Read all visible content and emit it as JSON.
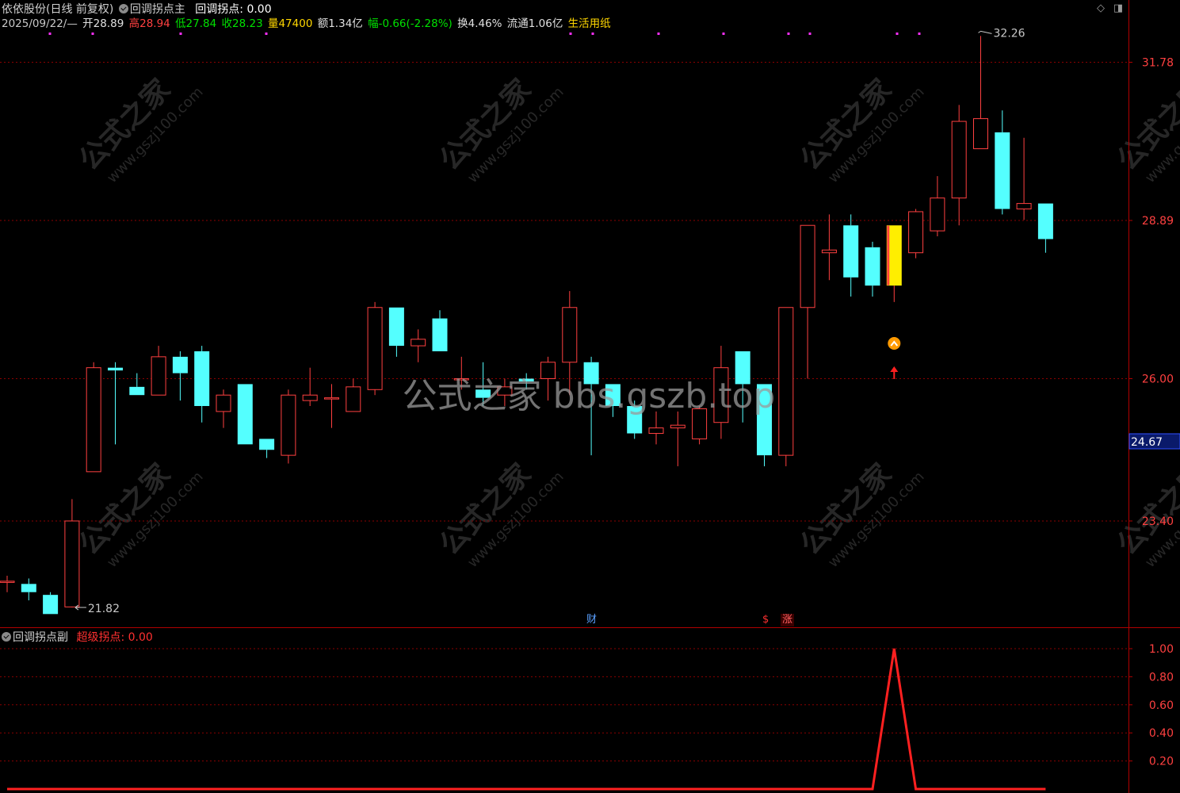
{
  "main_header": {
    "stock_name": "依依股份(日线 前复权)",
    "formula_name": "回调拐点主",
    "indicator": "回调拐点: 0.00"
  },
  "info_bar": {
    "date": "2025/09/22/—",
    "open": "开28.89",
    "high": "高28.94",
    "low": "低27.84",
    "close": "收28.23",
    "volume": "量47400",
    "amount": "额1.34亿",
    "change": "幅-0.66(-2.28%)",
    "turnover": "换4.46%",
    "float": "流通1.06亿",
    "sector": "生活用纸"
  },
  "price_axis": {
    "ticks": [
      "31.78",
      "28.89",
      "26.00",
      "23.40"
    ],
    "current_price": "24.67"
  },
  "annotations": {
    "max_label": "32.26",
    "min_label": "21.82"
  },
  "event_markers": [
    {
      "label": "财",
      "color": "#5aa0ff"
    },
    {
      "label": "$",
      "color": "#ff3030"
    },
    {
      "label": "涨",
      "color": "#ff6060"
    }
  ],
  "sub_header": {
    "formula_name": "回调拐点副",
    "indicator": "超级拐点: 0.00"
  },
  "sub_axis": {
    "ticks": [
      "1.00",
      "0.80",
      "0.60",
      "0.40",
      "0.20"
    ]
  },
  "watermarks": {
    "center": "公式之家 bbs.gszb.top",
    "tile_cn": "公式之家",
    "tile_url": "www.gszj100.com"
  },
  "colors": {
    "up": "#ff4040",
    "down": "#54ffff",
    "signal": "#ffee00",
    "grid": "#8b0000",
    "axis": "#b00000",
    "date": "#c8c8c8",
    "high": "#ff4040",
    "low": "#00e000",
    "close": "#00e000",
    "volume": "#ffd700",
    "change": "#00e000",
    "sector": "#ffd700"
  },
  "chart_data": {
    "type": "candlestick",
    "price_range": [
      21.1,
      33.0
    ],
    "signal_candle_index": 41,
    "candles": [
      {
        "o": 22.3,
        "h": 22.4,
        "l": 22.1,
        "c": 22.3
      },
      {
        "o": 22.25,
        "h": 22.35,
        "l": 21.95,
        "c": 22.1
      },
      {
        "o": 22.05,
        "h": 22.1,
        "l": 21.7,
        "c": 21.7
      },
      {
        "o": 21.83,
        "h": 23.8,
        "l": 21.82,
        "c": 23.4
      },
      {
        "o": 24.3,
        "h": 26.3,
        "l": 24.3,
        "c": 26.2
      },
      {
        "o": 26.2,
        "h": 26.3,
        "l": 24.8,
        "c": 26.15
      },
      {
        "o": 25.85,
        "h": 26.1,
        "l": 25.7,
        "c": 25.7
      },
      {
        "o": 25.7,
        "h": 26.6,
        "l": 25.7,
        "c": 26.4
      },
      {
        "o": 26.4,
        "h": 26.5,
        "l": 25.6,
        "c": 26.1
      },
      {
        "o": 26.5,
        "h": 26.6,
        "l": 25.2,
        "c": 25.5
      },
      {
        "o": 25.4,
        "h": 25.8,
        "l": 25.1,
        "c": 25.7
      },
      {
        "o": 25.9,
        "h": 25.9,
        "l": 24.8,
        "c": 24.8
      },
      {
        "o": 24.9,
        "h": 24.9,
        "l": 24.55,
        "c": 24.7
      },
      {
        "o": 24.6,
        "h": 25.8,
        "l": 24.45,
        "c": 25.7
      },
      {
        "o": 25.6,
        "h": 26.2,
        "l": 25.5,
        "c": 25.7
      },
      {
        "o": 25.65,
        "h": 25.9,
        "l": 25.1,
        "c": 25.65
      },
      {
        "o": 25.4,
        "h": 26.0,
        "l": 25.4,
        "c": 25.85
      },
      {
        "o": 25.8,
        "h": 27.4,
        "l": 25.7,
        "c": 27.3
      },
      {
        "o": 27.3,
        "h": 27.3,
        "l": 26.4,
        "c": 26.6
      },
      {
        "o": 26.6,
        "h": 26.9,
        "l": 26.3,
        "c": 26.72
      },
      {
        "o": 27.1,
        "h": 27.25,
        "l": 26.5,
        "c": 26.5
      },
      {
        "o": 26.0,
        "h": 26.4,
        "l": 25.8,
        "c": 26.0
      },
      {
        "o": 25.8,
        "h": 26.3,
        "l": 25.5,
        "c": 25.65
      },
      {
        "o": 25.7,
        "h": 26.0,
        "l": 25.5,
        "c": 25.85
      },
      {
        "o": 26.0,
        "h": 26.1,
        "l": 25.8,
        "c": 25.95
      },
      {
        "o": 26.0,
        "h": 26.4,
        "l": 25.6,
        "c": 26.3
      },
      {
        "o": 26.3,
        "h": 27.6,
        "l": 25.7,
        "c": 27.3
      },
      {
        "o": 26.3,
        "h": 26.4,
        "l": 24.6,
        "c": 25.9
      },
      {
        "o": 25.9,
        "h": 25.9,
        "l": 25.3,
        "c": 25.5
      },
      {
        "o": 25.5,
        "h": 25.6,
        "l": 24.9,
        "c": 25.0
      },
      {
        "o": 25.0,
        "h": 25.4,
        "l": 24.8,
        "c": 25.1
      },
      {
        "o": 25.1,
        "h": 25.4,
        "l": 24.4,
        "c": 25.15
      },
      {
        "o": 24.9,
        "h": 25.5,
        "l": 24.8,
        "c": 25.45
      },
      {
        "o": 25.2,
        "h": 26.6,
        "l": 24.9,
        "c": 26.2
      },
      {
        "o": 26.5,
        "h": 26.5,
        "l": 25.2,
        "c": 25.9
      },
      {
        "o": 25.9,
        "h": 25.9,
        "l": 24.4,
        "c": 24.6
      },
      {
        "o": 24.6,
        "h": 27.3,
        "l": 24.4,
        "c": 27.3
      },
      {
        "o": 27.3,
        "h": 28.8,
        "l": 26.0,
        "c": 28.8
      },
      {
        "o": 28.3,
        "h": 29.0,
        "l": 27.8,
        "c": 28.35
      },
      {
        "o": 28.8,
        "h": 29.0,
        "l": 27.5,
        "c": 27.85
      },
      {
        "o": 28.4,
        "h": 28.5,
        "l": 27.5,
        "c": 27.7
      },
      {
        "o": 27.7,
        "h": 28.8,
        "l": 27.4,
        "c": 28.8
      },
      {
        "o": 28.3,
        "h": 29.1,
        "l": 28.2,
        "c": 29.05
      },
      {
        "o": 28.7,
        "h": 29.7,
        "l": 28.6,
        "c": 29.3
      },
      {
        "o": 29.3,
        "h": 31.0,
        "l": 28.8,
        "c": 30.7
      },
      {
        "o": 30.2,
        "h": 32.26,
        "l": 30.2,
        "c": 30.75
      },
      {
        "o": 30.5,
        "h": 30.9,
        "l": 29.0,
        "c": 29.1
      },
      {
        "o": 29.1,
        "h": 30.4,
        "l": 28.9,
        "c": 29.2
      },
      {
        "o": 29.2,
        "h": 29.2,
        "l": 28.3,
        "c": 28.55
      }
    ],
    "sub_indicator": {
      "name": "超级拐点",
      "range": [
        0,
        1.0
      ],
      "values": [
        0,
        0,
        0,
        0,
        0,
        0,
        0,
        0,
        0,
        0,
        0,
        0,
        0,
        0,
        0,
        0,
        0,
        0,
        0,
        0,
        0,
        0,
        0,
        0,
        0,
        0,
        0,
        0,
        0,
        0,
        0,
        0,
        0,
        0,
        0,
        0,
        0,
        0,
        0,
        0,
        0,
        1,
        0,
        0,
        0,
        0,
        0,
        0,
        0
      ]
    }
  }
}
